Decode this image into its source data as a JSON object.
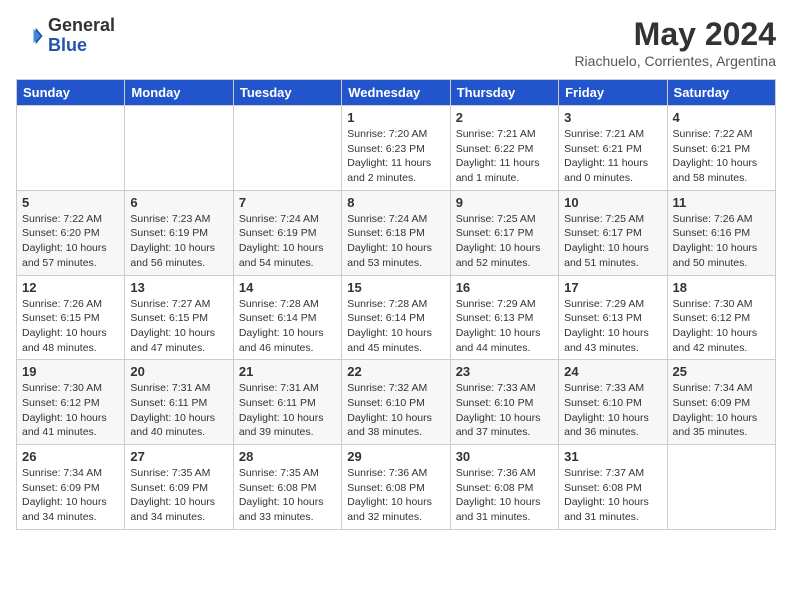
{
  "header": {
    "logo_general": "General",
    "logo_blue": "Blue",
    "title": "May 2024",
    "subtitle": "Riachuelo, Corrientes, Argentina"
  },
  "days_of_week": [
    "Sunday",
    "Monday",
    "Tuesday",
    "Wednesday",
    "Thursday",
    "Friday",
    "Saturday"
  ],
  "weeks": [
    [
      {
        "day": "",
        "info": ""
      },
      {
        "day": "",
        "info": ""
      },
      {
        "day": "",
        "info": ""
      },
      {
        "day": "1",
        "info": "Sunrise: 7:20 AM\nSunset: 6:23 PM\nDaylight: 11 hours\nand 2 minutes."
      },
      {
        "day": "2",
        "info": "Sunrise: 7:21 AM\nSunset: 6:22 PM\nDaylight: 11 hours\nand 1 minute."
      },
      {
        "day": "3",
        "info": "Sunrise: 7:21 AM\nSunset: 6:21 PM\nDaylight: 11 hours\nand 0 minutes."
      },
      {
        "day": "4",
        "info": "Sunrise: 7:22 AM\nSunset: 6:21 PM\nDaylight: 10 hours\nand 58 minutes."
      }
    ],
    [
      {
        "day": "5",
        "info": "Sunrise: 7:22 AM\nSunset: 6:20 PM\nDaylight: 10 hours\nand 57 minutes."
      },
      {
        "day": "6",
        "info": "Sunrise: 7:23 AM\nSunset: 6:19 PM\nDaylight: 10 hours\nand 56 minutes."
      },
      {
        "day": "7",
        "info": "Sunrise: 7:24 AM\nSunset: 6:19 PM\nDaylight: 10 hours\nand 54 minutes."
      },
      {
        "day": "8",
        "info": "Sunrise: 7:24 AM\nSunset: 6:18 PM\nDaylight: 10 hours\nand 53 minutes."
      },
      {
        "day": "9",
        "info": "Sunrise: 7:25 AM\nSunset: 6:17 PM\nDaylight: 10 hours\nand 52 minutes."
      },
      {
        "day": "10",
        "info": "Sunrise: 7:25 AM\nSunset: 6:17 PM\nDaylight: 10 hours\nand 51 minutes."
      },
      {
        "day": "11",
        "info": "Sunrise: 7:26 AM\nSunset: 6:16 PM\nDaylight: 10 hours\nand 50 minutes."
      }
    ],
    [
      {
        "day": "12",
        "info": "Sunrise: 7:26 AM\nSunset: 6:15 PM\nDaylight: 10 hours\nand 48 minutes."
      },
      {
        "day": "13",
        "info": "Sunrise: 7:27 AM\nSunset: 6:15 PM\nDaylight: 10 hours\nand 47 minutes."
      },
      {
        "day": "14",
        "info": "Sunrise: 7:28 AM\nSunset: 6:14 PM\nDaylight: 10 hours\nand 46 minutes."
      },
      {
        "day": "15",
        "info": "Sunrise: 7:28 AM\nSunset: 6:14 PM\nDaylight: 10 hours\nand 45 minutes."
      },
      {
        "day": "16",
        "info": "Sunrise: 7:29 AM\nSunset: 6:13 PM\nDaylight: 10 hours\nand 44 minutes."
      },
      {
        "day": "17",
        "info": "Sunrise: 7:29 AM\nSunset: 6:13 PM\nDaylight: 10 hours\nand 43 minutes."
      },
      {
        "day": "18",
        "info": "Sunrise: 7:30 AM\nSunset: 6:12 PM\nDaylight: 10 hours\nand 42 minutes."
      }
    ],
    [
      {
        "day": "19",
        "info": "Sunrise: 7:30 AM\nSunset: 6:12 PM\nDaylight: 10 hours\nand 41 minutes."
      },
      {
        "day": "20",
        "info": "Sunrise: 7:31 AM\nSunset: 6:11 PM\nDaylight: 10 hours\nand 40 minutes."
      },
      {
        "day": "21",
        "info": "Sunrise: 7:31 AM\nSunset: 6:11 PM\nDaylight: 10 hours\nand 39 minutes."
      },
      {
        "day": "22",
        "info": "Sunrise: 7:32 AM\nSunset: 6:10 PM\nDaylight: 10 hours\nand 38 minutes."
      },
      {
        "day": "23",
        "info": "Sunrise: 7:33 AM\nSunset: 6:10 PM\nDaylight: 10 hours\nand 37 minutes."
      },
      {
        "day": "24",
        "info": "Sunrise: 7:33 AM\nSunset: 6:10 PM\nDaylight: 10 hours\nand 36 minutes."
      },
      {
        "day": "25",
        "info": "Sunrise: 7:34 AM\nSunset: 6:09 PM\nDaylight: 10 hours\nand 35 minutes."
      }
    ],
    [
      {
        "day": "26",
        "info": "Sunrise: 7:34 AM\nSunset: 6:09 PM\nDaylight: 10 hours\nand 34 minutes."
      },
      {
        "day": "27",
        "info": "Sunrise: 7:35 AM\nSunset: 6:09 PM\nDaylight: 10 hours\nand 34 minutes."
      },
      {
        "day": "28",
        "info": "Sunrise: 7:35 AM\nSunset: 6:08 PM\nDaylight: 10 hours\nand 33 minutes."
      },
      {
        "day": "29",
        "info": "Sunrise: 7:36 AM\nSunset: 6:08 PM\nDaylight: 10 hours\nand 32 minutes."
      },
      {
        "day": "30",
        "info": "Sunrise: 7:36 AM\nSunset: 6:08 PM\nDaylight: 10 hours\nand 31 minutes."
      },
      {
        "day": "31",
        "info": "Sunrise: 7:37 AM\nSunset: 6:08 PM\nDaylight: 10 hours\nand 31 minutes."
      },
      {
        "day": "",
        "info": ""
      }
    ]
  ]
}
